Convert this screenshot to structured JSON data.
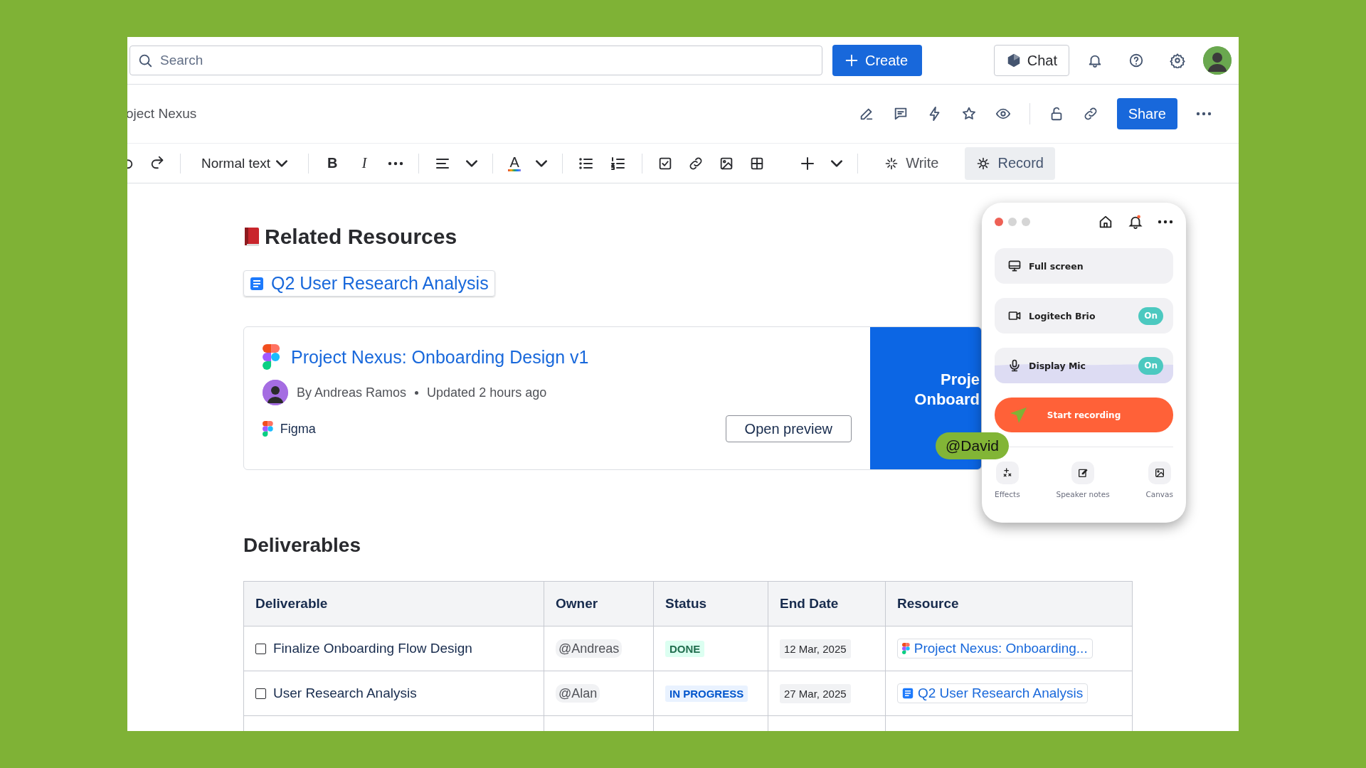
{
  "top_bar": {
    "search": {
      "placeholder": "Search"
    },
    "create_button": "Create",
    "chat_button": "Chat"
  },
  "page_header": {
    "breadcrumb": "oject Nexus",
    "share_button": "Share"
  },
  "toolbar": {
    "text_style": "Normal text",
    "format_buttons": [
      {
        "kind": "bold",
        "label": "B"
      },
      {
        "kind": "italic",
        "label": "I"
      }
    ],
    "text_color": "A",
    "tools": [
      {
        "kind": "write",
        "label": "Write",
        "selected": false
      },
      {
        "kind": "record",
        "label": "Record",
        "selected": true
      }
    ]
  },
  "related": {
    "title": "Related Resources",
    "link": "Q2 User Research Analysis",
    "card": {
      "title": "Project Nexus: Onboarding Design v1",
      "author": "By Andreas Ramos",
      "updated": "Updated 2 hours ago",
      "source": "Figma",
      "button": "Open preview",
      "preview_lines": [
        "Proje",
        "Onboard"
      ]
    }
  },
  "mention": "@David",
  "recorder": {
    "items": [
      {
        "kind": "screen",
        "label": "Full screen"
      },
      {
        "kind": "camera",
        "label": "Logitech Brio",
        "on": true,
        "badge": "On"
      },
      {
        "kind": "mic",
        "label": "Display Mic",
        "on": true,
        "badge": "On"
      }
    ],
    "start_button": "Start recording",
    "actions": [
      {
        "kind": "effects",
        "label": "Effects"
      },
      {
        "kind": "notes",
        "label": "Speaker notes"
      },
      {
        "kind": "canvas",
        "label": "Canvas"
      }
    ]
  },
  "deliverables": {
    "title": "Deliverables",
    "columns": [
      "Deliverable",
      "Owner",
      "Status",
      "End Date",
      "Resource"
    ],
    "rows": [
      {
        "deliverable": "Finalize Onboarding Flow Design",
        "checked": false,
        "owner": "@Andreas",
        "status": {
          "label": "DONE",
          "kind": "done"
        },
        "end_date": "12 Mar, 2025",
        "resource": {
          "label": "Project Nexus: Onboarding...",
          "kind": "figma"
        }
      },
      {
        "deliverable": "User Research Analysis",
        "checked": false,
        "owner": "@Alan",
        "status": {
          "label": "IN PROGRESS",
          "kind": "progress"
        },
        "end_date": "27 Mar, 2025",
        "resource": {
          "label": "Q2 User Research Analysis",
          "kind": "doc"
        }
      }
    ]
  }
}
